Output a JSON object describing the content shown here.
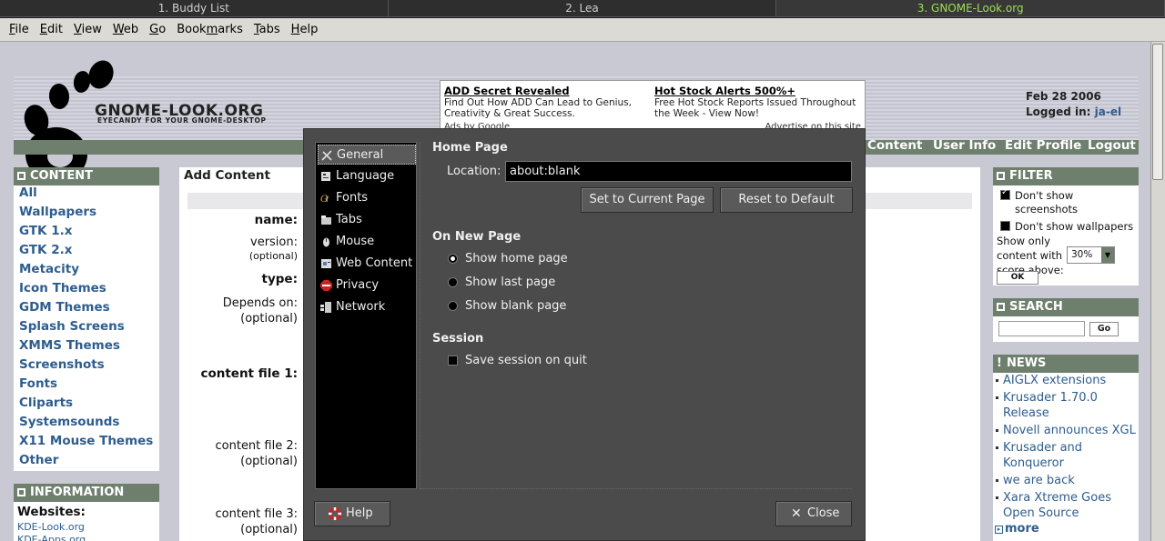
{
  "window_tabs": [
    "1. Buddy List",
    "2. Lea",
    "3. GNOME-Look.org"
  ],
  "menubar": {
    "file": "F",
    "file_rest": "ile",
    "edit": "E",
    "edit_rest": "dit",
    "view": "V",
    "view_rest": "iew",
    "web": "W",
    "web_rest": "eb",
    "go": "G",
    "go_rest": "o",
    "bookmarks": "Book",
    "bookmarks_u": "m",
    "bookmarks_rest": "arks",
    "tabs": "T",
    "tabs_rest": "abs",
    "help": "H",
    "help_rest": "elp"
  },
  "site": {
    "logo_text": "GNOME-LOOK.ORG",
    "logo_sub": "EYECANDY FOR YOUR GNOME-DESKTOP",
    "date": "Feb 28 2006",
    "logged_in_label": "Logged in:",
    "username": "ja-el",
    "ad": {
      "title1": "ADD Secret Revealed",
      "body1": "Find Out How ADD Can Lead to Genius, Creativity & Great Success.",
      "title2": "Hot Stock Alerts 500%+",
      "body2": "Free Hot Stock Reports Issued Throughout the Week - View Now!",
      "footer_left": "Ads by Google",
      "footer_right": "Advertise on this site"
    },
    "nav": [
      "Content",
      "User Info",
      "Edit Profile",
      "Logout"
    ],
    "content_header": "CONTENT",
    "content_links": [
      "All",
      "Wallpapers",
      "GTK 1.x",
      "GTK 2.x",
      "Metacity",
      "Icon Themes",
      "GDM Themes",
      "Splash Screens",
      "XMMS Themes",
      "Screenshots",
      "Fonts",
      "Cliparts",
      "Systemsounds",
      "X11 Mouse Themes",
      "Other"
    ],
    "info_header": "INFORMATION",
    "info_websites": "Websites:",
    "info_links": [
      "KDE-Look.org",
      "KDE-Apps.org"
    ],
    "main_tab": "Add Content",
    "form_labels": {
      "name": "name:",
      "version": "version:",
      "optional": "(optional)",
      "type": "type:",
      "depends": "Depends on:",
      "content1": "content file 1:",
      "content2": "content file 2:",
      "content3": "content file 3:"
    },
    "filter_header": "FILTER",
    "filter": {
      "no_screenshots": "Don't show screenshots",
      "no_wallpapers": "Don't show wallpapers",
      "score_label": "Show only content with score above:",
      "score_value": "30%",
      "ok": "OK"
    },
    "search_header": "SEARCH",
    "search_go": "Go",
    "news_header": "NEWS",
    "news": [
      "AIGLX extensions",
      "Krusader 1.70.0 Release",
      "Novell announces XGL",
      "Krusader and Konqueror",
      "we are back",
      "Xara Xtreme Goes Open Source"
    ],
    "news_more": "more"
  },
  "dialog": {
    "categories": [
      "General",
      "Language",
      "Fonts",
      "Tabs",
      "Mouse",
      "Web Content",
      "Privacy",
      "Network"
    ],
    "selected_category": "General",
    "home_page_header": "Home Page",
    "location_label": "Location:",
    "location_value": "about:blank",
    "set_current": "Set to Current Page",
    "reset_default": "Reset to Default",
    "on_new_page_header": "On New Page",
    "radio_home": "Show home page",
    "radio_last": "Show last page",
    "radio_blank": "Show blank page",
    "session_header": "Session",
    "save_session": "Save session on quit",
    "help": "Help",
    "close": "Close"
  }
}
